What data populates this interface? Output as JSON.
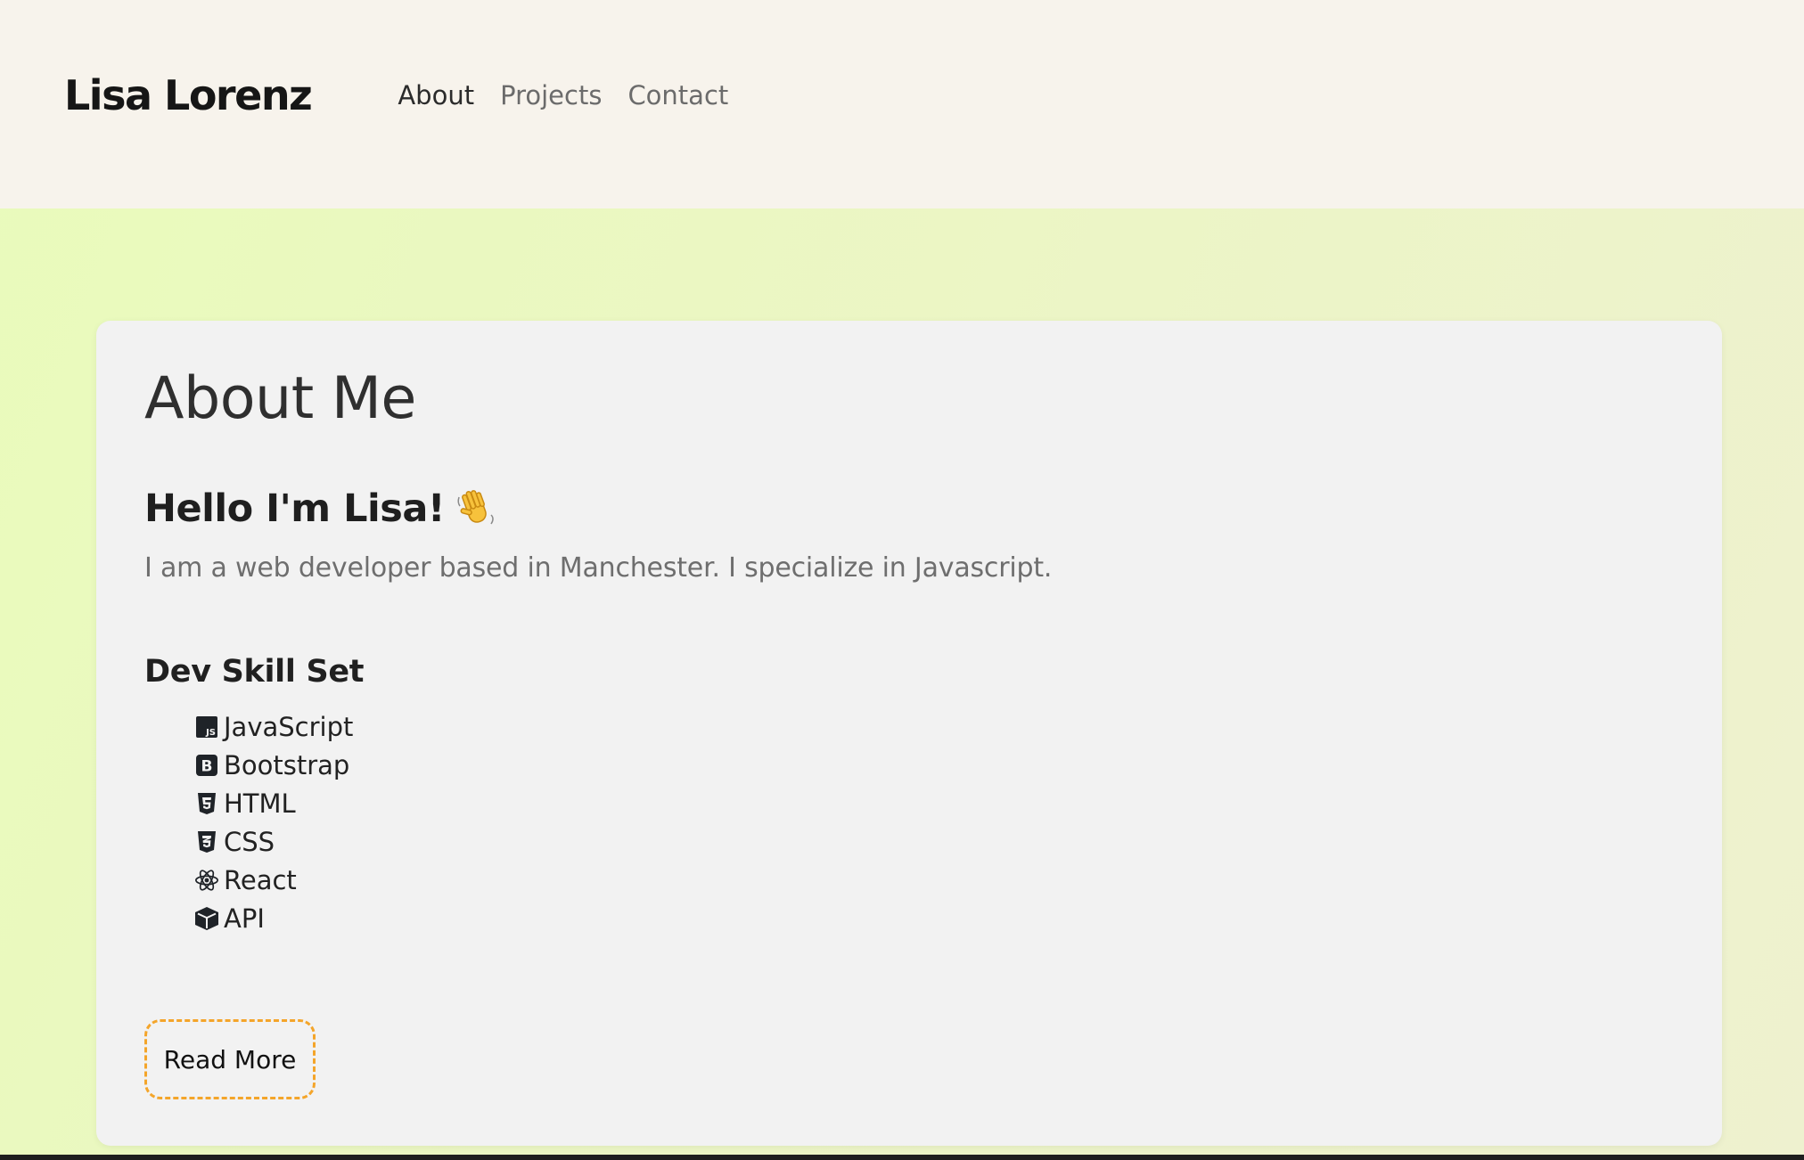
{
  "nav": {
    "brand": "Lisa Lorenz",
    "links": [
      {
        "label": "About",
        "active": true
      },
      {
        "label": "Projects",
        "active": false
      },
      {
        "label": "Contact",
        "active": false
      }
    ]
  },
  "about": {
    "title": "About Me",
    "greeting": "Hello I'm Lisa!",
    "greeting_icon": "waving-hand-icon",
    "intro": "I am a web developer based in Manchester. I specialize in Javascript.",
    "skills_title": "Dev Skill Set",
    "skills": [
      {
        "label": "JavaScript",
        "icon": "javascript-icon"
      },
      {
        "label": "Bootstrap",
        "icon": "bootstrap-icon"
      },
      {
        "label": "HTML",
        "icon": "html5-icon"
      },
      {
        "label": "CSS",
        "icon": "css3-icon"
      },
      {
        "label": "React",
        "icon": "react-icon"
      },
      {
        "label": "API",
        "icon": "box-icon"
      }
    ],
    "read_more_label": "Read More"
  },
  "colors": {
    "accent_border": "#f4a52a",
    "nav_background": "#f7f3ec",
    "card_background": "#f2f2f2",
    "page_background": "#ecf5c6"
  }
}
